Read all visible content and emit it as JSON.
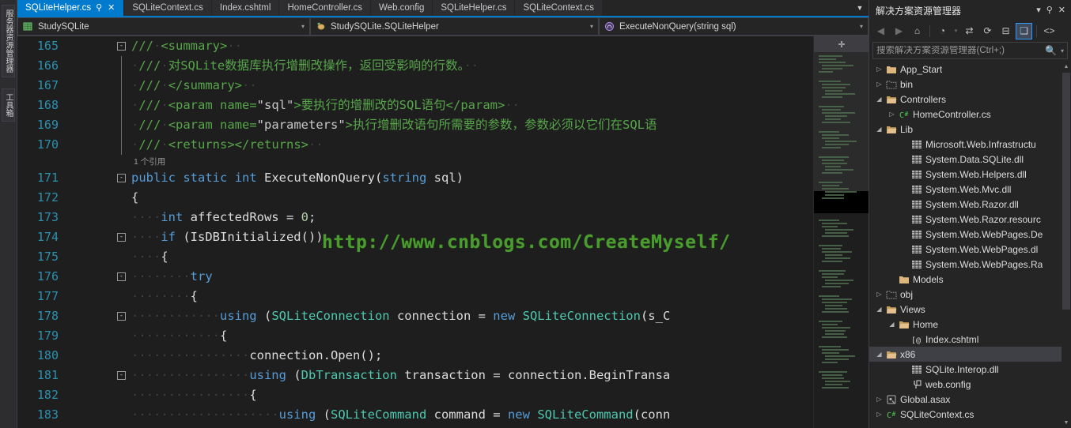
{
  "vertical_dock": {
    "items": [
      {
        "label": "服务器资源管理器",
        "name": "server-explorer"
      },
      {
        "label": "工具箱",
        "name": "toolbox"
      }
    ]
  },
  "tabs": {
    "items": [
      {
        "label": "SQLiteHelper.cs",
        "active": true,
        "pin": "⚲",
        "close": "✕"
      },
      {
        "label": "SQLiteContext.cs",
        "active": false
      },
      {
        "label": "Index.cshtml",
        "active": false
      },
      {
        "label": "HomeController.cs",
        "active": false
      },
      {
        "label": "Web.config",
        "active": false
      },
      {
        "label": "SQLiteHelper.cs",
        "active": false
      },
      {
        "label": "SQLiteContext.cs",
        "active": false
      }
    ],
    "overflow_caret": "▼"
  },
  "navbar": {
    "project": "StudySQLite",
    "project_icon": "project-icon",
    "type": "StudySQLite.SQLiteHelper",
    "type_icon": "class-icon",
    "member": "ExecuteNonQuery(string sql)",
    "member_icon": "method-icon",
    "caret": "▾"
  },
  "editor": {
    "codelens": "1 个引用",
    "watermark": "http://www.cnblogs.com/CreateMyself/",
    "minimap_handle": "✛",
    "lines": [
      {
        "number": "165",
        "fold": "-",
        "segments": [
          {
            "t": "///",
            "c": "c-com"
          },
          {
            "t": "·",
            "c": "c-dot"
          },
          {
            "t": "<summary>",
            "c": "c-com"
          },
          {
            "t": "··",
            "c": "c-dot"
          }
        ]
      },
      {
        "number": "166",
        "bar": true,
        "segments": [
          {
            "t": "·",
            "c": "c-dot"
          },
          {
            "t": "///",
            "c": "c-com"
          },
          {
            "t": "·",
            "c": "c-dot"
          },
          {
            "t": "对SQLite数据库执行增删改操作，返回受影响的行数。",
            "c": "c-com"
          },
          {
            "t": "··",
            "c": "c-dot"
          }
        ]
      },
      {
        "number": "167",
        "bar": true,
        "segments": [
          {
            "t": "·",
            "c": "c-dot"
          },
          {
            "t": "///",
            "c": "c-com"
          },
          {
            "t": "·",
            "c": "c-dot"
          },
          {
            "t": "</summary>",
            "c": "c-com"
          },
          {
            "t": "··",
            "c": "c-dot"
          }
        ]
      },
      {
        "number": "168",
        "bar": true,
        "segments": [
          {
            "t": "·",
            "c": "c-dot"
          },
          {
            "t": "///",
            "c": "c-com"
          },
          {
            "t": "·",
            "c": "c-dot"
          },
          {
            "t": "<param name=",
            "c": "c-com"
          },
          {
            "t": "\"sql\"",
            "c": "c-xmlq"
          },
          {
            "t": ">要执行的增删改的SQL语句</param>",
            "c": "c-com"
          },
          {
            "t": "··",
            "c": "c-dot"
          }
        ]
      },
      {
        "number": "169",
        "bar": true,
        "segments": [
          {
            "t": "·",
            "c": "c-dot"
          },
          {
            "t": "///",
            "c": "c-com"
          },
          {
            "t": "·",
            "c": "c-dot"
          },
          {
            "t": "<param name=",
            "c": "c-com"
          },
          {
            "t": "\"parameters\"",
            "c": "c-xmlq"
          },
          {
            "t": ">执行增删改语句所需要的参数，参数必须以它们在SQL语",
            "c": "c-com"
          }
        ]
      },
      {
        "number": "170",
        "bar": true,
        "segments": [
          {
            "t": "·",
            "c": "c-dot"
          },
          {
            "t": "///",
            "c": "c-com"
          },
          {
            "t": "·",
            "c": "c-dot"
          },
          {
            "t": "<returns></returns>",
            "c": "c-com"
          },
          {
            "t": "··",
            "c": "c-dot"
          }
        ]
      },
      {
        "number": "171",
        "fold": "-",
        "codelens_above": true,
        "segments": [
          {
            "t": "public",
            "c": "c-kw"
          },
          {
            "t": " ",
            "c": "c-plain"
          },
          {
            "t": "static",
            "c": "c-kw"
          },
          {
            "t": " ",
            "c": "c-plain"
          },
          {
            "t": "int",
            "c": "c-kw"
          },
          {
            "t": " ExecuteNonQuery(",
            "c": "c-plain"
          },
          {
            "t": "string",
            "c": "c-kw"
          },
          {
            "t": " sql)",
            "c": "c-plain"
          }
        ]
      },
      {
        "number": "172",
        "segments": [
          {
            "t": "{",
            "c": "c-plain"
          }
        ]
      },
      {
        "number": "173",
        "segments": [
          {
            "t": "····",
            "c": "c-dot"
          },
          {
            "t": "int",
            "c": "c-kw"
          },
          {
            "t": " affectedRows = ",
            "c": "c-plain"
          },
          {
            "t": "0",
            "c": "c-num"
          },
          {
            "t": ";",
            "c": "c-plain"
          }
        ]
      },
      {
        "number": "174",
        "fold": "-",
        "segments": [
          {
            "t": "····",
            "c": "c-dot"
          },
          {
            "t": "if",
            "c": "c-kw"
          },
          {
            "t": " (IsDBInitialized())",
            "c": "c-plain"
          }
        ]
      },
      {
        "number": "175",
        "segments": [
          {
            "t": "····",
            "c": "c-dot"
          },
          {
            "t": "{",
            "c": "c-plain"
          }
        ]
      },
      {
        "number": "176",
        "fold": "-",
        "segments": [
          {
            "t": "········",
            "c": "c-dot"
          },
          {
            "t": "try",
            "c": "c-kw"
          }
        ]
      },
      {
        "number": "177",
        "segments": [
          {
            "t": "········",
            "c": "c-dot"
          },
          {
            "t": "{",
            "c": "c-plain"
          }
        ]
      },
      {
        "number": "178",
        "fold": "-",
        "segments": [
          {
            "t": "············",
            "c": "c-dot"
          },
          {
            "t": "using",
            "c": "c-kw"
          },
          {
            "t": " (",
            "c": "c-plain"
          },
          {
            "t": "SQLiteConnection",
            "c": "c-type"
          },
          {
            "t": " connection = ",
            "c": "c-plain"
          },
          {
            "t": "new",
            "c": "c-kw"
          },
          {
            "t": " ",
            "c": "c-plain"
          },
          {
            "t": "SQLiteConnection",
            "c": "c-type"
          },
          {
            "t": "(s_C",
            "c": "c-plain"
          }
        ]
      },
      {
        "number": "179",
        "segments": [
          {
            "t": "············",
            "c": "c-dot"
          },
          {
            "t": "{",
            "c": "c-plain"
          }
        ]
      },
      {
        "number": "180",
        "segments": [
          {
            "t": "················",
            "c": "c-dot"
          },
          {
            "t": "connection.Open();",
            "c": "c-plain"
          }
        ]
      },
      {
        "number": "181",
        "fold": "-",
        "segments": [
          {
            "t": "················",
            "c": "c-dot"
          },
          {
            "t": "using",
            "c": "c-kw"
          },
          {
            "t": " (",
            "c": "c-plain"
          },
          {
            "t": "DbTransaction",
            "c": "c-type"
          },
          {
            "t": " transaction = connection.BeginTransa",
            "c": "c-plain"
          }
        ]
      },
      {
        "number": "182",
        "segments": [
          {
            "t": "················",
            "c": "c-dot"
          },
          {
            "t": "{",
            "c": "c-plain"
          }
        ]
      },
      {
        "number": "183",
        "segments": [
          {
            "t": "····················",
            "c": "c-dot"
          },
          {
            "t": "using",
            "c": "c-kw"
          },
          {
            "t": " (",
            "c": "c-plain"
          },
          {
            "t": "SQLiteCommand",
            "c": "c-type"
          },
          {
            "t": " command = ",
            "c": "c-plain"
          },
          {
            "t": "new",
            "c": "c-kw"
          },
          {
            "t": " ",
            "c": "c-plain"
          },
          {
            "t": "SQLiteCommand",
            "c": "c-type"
          },
          {
            "t": "(conn",
            "c": "c-plain"
          }
        ]
      }
    ]
  },
  "solution_explorer": {
    "title": "解决方案资源管理器",
    "title_caret": "▾",
    "pin": "⚲",
    "close": "✕",
    "toolbar": [
      {
        "name": "back-icon",
        "glyph": "◀",
        "disabled": true
      },
      {
        "name": "forward-icon",
        "glyph": "▶",
        "disabled": true
      },
      {
        "name": "home-icon",
        "glyph": "⌂",
        "disabled": false
      },
      {
        "name": "pending-changes-icon",
        "glyph": "◔",
        "disabled": false
      },
      {
        "name": "sync-icon",
        "glyph": "⇄",
        "disabled": false
      },
      {
        "name": "refresh-icon",
        "glyph": "⟳",
        "disabled": false
      },
      {
        "name": "collapse-all-icon",
        "glyph": "⊟",
        "disabled": false
      },
      {
        "name": "show-all-files-icon",
        "glyph": "❏",
        "selected": true
      },
      {
        "name": "view-code-icon",
        "glyph": "<>",
        "disabled": false
      }
    ],
    "search": {
      "placeholder": "搜索解决方案资源管理器(Ctrl+;)",
      "value": "",
      "icon": "search-icon",
      "caret": "▾"
    },
    "tree": [
      {
        "label": "App_Start",
        "indent": 1,
        "expander": "▷",
        "icon": "folder-closed-icon",
        "selected": false
      },
      {
        "label": "bin",
        "indent": 1,
        "expander": "▷",
        "icon": "folder-dashed-icon",
        "selected": false
      },
      {
        "label": "Controllers",
        "indent": 1,
        "expander": "◢",
        "icon": "folder-open-icon",
        "selected": false
      },
      {
        "label": "HomeController.cs",
        "indent": 2,
        "expander": "▷",
        "icon": "csharp-icon",
        "selected": false
      },
      {
        "label": "Lib",
        "indent": 1,
        "expander": "◢",
        "icon": "folder-open-icon",
        "selected": false
      },
      {
        "label": "Microsoft.Web.Infrastructu",
        "indent": 3,
        "expander": "",
        "icon": "dll-icon",
        "selected": false
      },
      {
        "label": "System.Data.SQLite.dll",
        "indent": 3,
        "expander": "",
        "icon": "dll-icon",
        "selected": false
      },
      {
        "label": "System.Web.Helpers.dll",
        "indent": 3,
        "expander": "",
        "icon": "dll-icon",
        "selected": false
      },
      {
        "label": "System.Web.Mvc.dll",
        "indent": 3,
        "expander": "",
        "icon": "dll-icon",
        "selected": false
      },
      {
        "label": "System.Web.Razor.dll",
        "indent": 3,
        "expander": "",
        "icon": "dll-icon",
        "selected": false
      },
      {
        "label": "System.Web.Razor.resourc",
        "indent": 3,
        "expander": "",
        "icon": "dll-icon",
        "selected": false
      },
      {
        "label": "System.Web.WebPages.De",
        "indent": 3,
        "expander": "",
        "icon": "dll-icon",
        "selected": false
      },
      {
        "label": "System.Web.WebPages.dl",
        "indent": 3,
        "expander": "",
        "icon": "dll-icon",
        "selected": false
      },
      {
        "label": "System.Web.WebPages.Ra",
        "indent": 3,
        "expander": "",
        "icon": "dll-icon",
        "selected": false
      },
      {
        "label": "Models",
        "indent": 2,
        "expander": "",
        "icon": "folder-closed-icon",
        "selected": false
      },
      {
        "label": "obj",
        "indent": 1,
        "expander": "▷",
        "icon": "folder-dashed-icon",
        "selected": false
      },
      {
        "label": "Views",
        "indent": 1,
        "expander": "◢",
        "icon": "folder-open-icon",
        "selected": false
      },
      {
        "label": "Home",
        "indent": 2,
        "expander": "◢",
        "icon": "folder-open-icon",
        "selected": false
      },
      {
        "label": "Index.cshtml",
        "indent": 3,
        "expander": "",
        "icon": "cshtml-icon",
        "selected": false
      },
      {
        "label": "x86",
        "indent": 1,
        "expander": "◢",
        "icon": "folder-open-icon",
        "selected": true
      },
      {
        "label": "SQLite.Interop.dll",
        "indent": 3,
        "expander": "",
        "icon": "dll-icon",
        "selected": false
      },
      {
        "label": "web.config",
        "indent": 3,
        "expander": "",
        "icon": "config-icon",
        "selected": false
      },
      {
        "label": "Global.asax",
        "indent": 1,
        "expander": "▷",
        "icon": "asax-icon",
        "selected": false
      },
      {
        "label": "SQLiteContext.cs",
        "indent": 1,
        "expander": "▷",
        "icon": "csharp-icon",
        "selected": false
      }
    ],
    "scroll": {
      "up": "▲",
      "down": "▼"
    }
  },
  "colors": {
    "accent": "#007acc",
    "editor_bg": "#1e1e1e",
    "chrome_bg": "#252526",
    "comment_green": "#57a64a",
    "keyword_blue": "#569cd6",
    "type_teal": "#4ec9b0",
    "linenum_blue": "#2b91af",
    "watermark_green": "#4a9c2f",
    "selection_gray": "#3f3f46"
  }
}
